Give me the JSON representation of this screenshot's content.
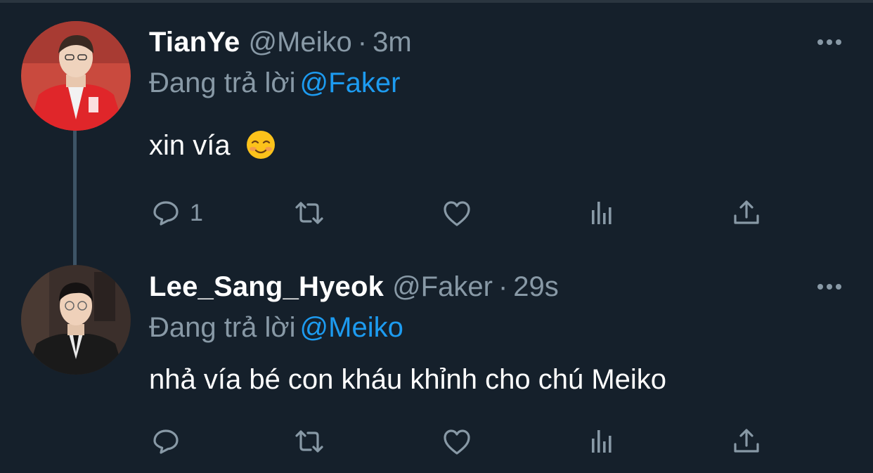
{
  "colors": {
    "background": "#15202b",
    "text_primary": "#ffffff",
    "text_secondary": "#8899a6",
    "accent": "#1d9bf0",
    "thread_line": "#3d5466"
  },
  "tweets": [
    {
      "display_name": "TianYe",
      "handle": "@Meiko",
      "separator": "·",
      "time": "3m",
      "replying_prefix": "Đang trả lời",
      "replying_to": "@Faker",
      "text": "xin vía",
      "emoji": "smiling-face-icon",
      "reply_count": "1",
      "icons": [
        "reply-icon",
        "retweet-icon",
        "like-icon",
        "analytics-icon",
        "share-icon",
        "more-icon"
      ]
    },
    {
      "display_name": "Lee_Sang_Hyeok",
      "handle": "@Faker",
      "separator": "·",
      "time": "29s",
      "replying_prefix": "Đang trả lời",
      "replying_to": "@Meiko",
      "text": "nhả vía bé con kháu khỉnh cho chú Meiko",
      "reply_count": "",
      "icons": [
        "reply-icon",
        "retweet-icon",
        "like-icon",
        "analytics-icon",
        "share-icon",
        "more-icon"
      ]
    }
  ]
}
